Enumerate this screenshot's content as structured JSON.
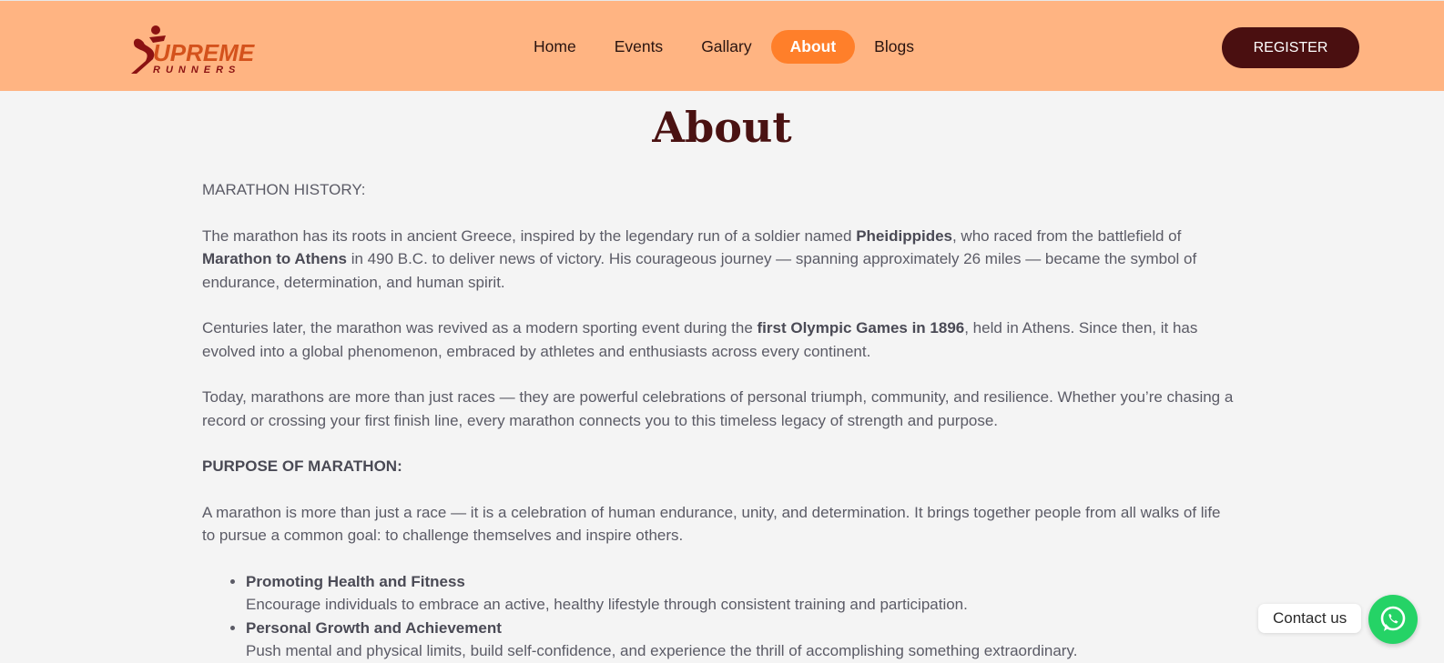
{
  "brand": {
    "logo_text": "UPREME",
    "logo_sub": "RUNNERS",
    "logo_initial": "S"
  },
  "nav": [
    {
      "label": "Home",
      "active": false
    },
    {
      "label": "Events",
      "active": false
    },
    {
      "label": "Gallary",
      "active": false
    },
    {
      "label": "About",
      "active": true
    },
    {
      "label": "Blogs",
      "active": false
    }
  ],
  "register_label": "REGISTER",
  "page_title": "About",
  "history_heading": "MARATHON HISTORY:",
  "history_p1": {
    "t1": "The marathon has its roots in ancient Greece, inspired by the legendary run of a soldier named ",
    "b1": "Pheidippides",
    "t2": ", who raced from the battlefield of ",
    "b2": "Marathon to Athens",
    "t3": " in 490 B.C. to deliver news of victory. His courageous journey — spanning approximately 26 miles — became the symbol of endurance, determination, and human spirit."
  },
  "history_p2": {
    "t1": "Centuries later, the marathon was revived as a modern sporting event during the ",
    "b1": "first Olympic Games in 1896",
    "t2": ", held in Athens. Since then, it has evolved into a global phenomenon, embraced by athletes and enthusiasts across every continent."
  },
  "history_p3": "Today, marathons are more than just races — they are powerful celebrations of personal triumph, community, and resilience. Whether you’re chasing a record or crossing your first finish line, every marathon connects you to this timeless legacy of strength and purpose.",
  "purpose_heading": "PURPOSE OF MARATHON:",
  "purpose_p1": "A marathon is more than just a race — it is a celebration of human endurance, unity, and determination. It brings together people from all walks of life to pursue a common goal: to challenge themselves and inspire others.",
  "purpose_items": [
    {
      "title": "Promoting Health and Fitness",
      "desc": "Encourage individuals to embrace an active, healthy lifestyle through consistent training and participation."
    },
    {
      "title": "Personal Growth and Achievement",
      "desc": "Push mental and physical limits, build self-confidence, and experience the thrill of accomplishing something extraordinary."
    }
  ],
  "contact_label": "Contact us",
  "colors": {
    "header_bg": "#ffb482",
    "active_nav": "#ff7f2a",
    "register_bg": "#4a0f10",
    "title": "#4a1212",
    "whatsapp": "#25d366"
  },
  "icons": {
    "contact": "whatsapp-icon",
    "logo": "runner-icon"
  }
}
